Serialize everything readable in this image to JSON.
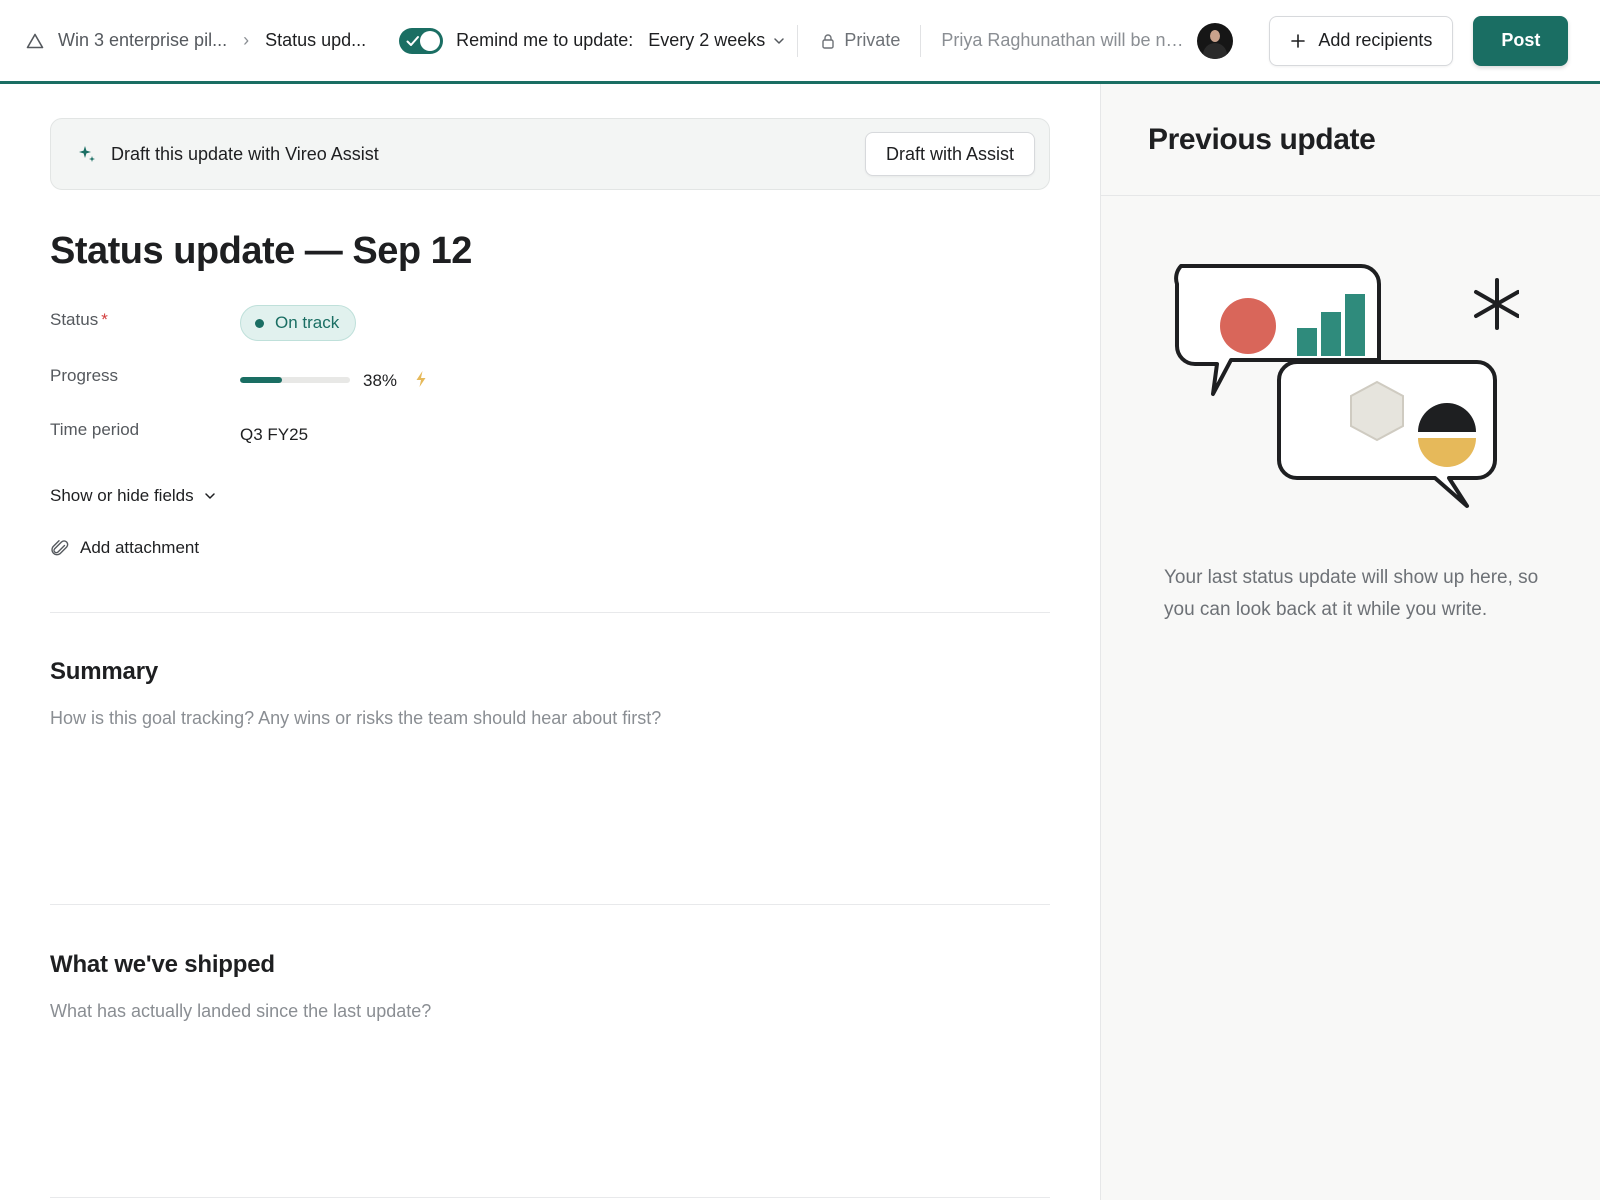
{
  "header": {
    "goal_crumb": "Win 3 enterprise pil...",
    "current_crumb": "Status upd...",
    "remind_label": "Remind me to update:",
    "frequency": "Every 2 weeks",
    "privacy": "Private",
    "notify_text": "Priya Raghunathan will be no...",
    "add_recipients": "Add recipients",
    "post": "Post"
  },
  "assist": {
    "banner_text": "Draft this update with Vireo Assist",
    "button": "Draft with Assist"
  },
  "form": {
    "title": "Status update — Sep 12",
    "status_label": "Status",
    "required_mark": "*",
    "status_value": "On track",
    "progress_label": "Progress",
    "progress_value": "38%",
    "progress_fraction": 0.38,
    "period_label": "Time period",
    "period_value": "Q3 FY25",
    "show_hide": "Show or hide fields",
    "add_attachment": "Add attachment"
  },
  "sections": {
    "summary_title": "Summary",
    "summary_placeholder": "How is this goal tracking? Any wins or risks the team should hear about first?",
    "shipped_title": "What we've shipped",
    "shipped_placeholder": "What has actually landed since the last update?"
  },
  "sidebar": {
    "title": "Previous update",
    "empty_text": "Your last status update will show up here, so you can look back at it while you write."
  },
  "colors": {
    "accent": "#1a6e63",
    "status_bg": "#e1f1ee",
    "illustration_red": "#d9665a",
    "illustration_teal": "#2f8b7c",
    "illustration_yellow": "#e6b95a"
  },
  "icons": {
    "goal": "triangle-icon",
    "separator": "chevron-right-icon",
    "toggle": "check-icon",
    "privacy": "lock-icon",
    "add": "plus-icon",
    "assist": "sparkle-icon",
    "progress": "bolt-icon",
    "attachment": "paperclip-icon"
  }
}
